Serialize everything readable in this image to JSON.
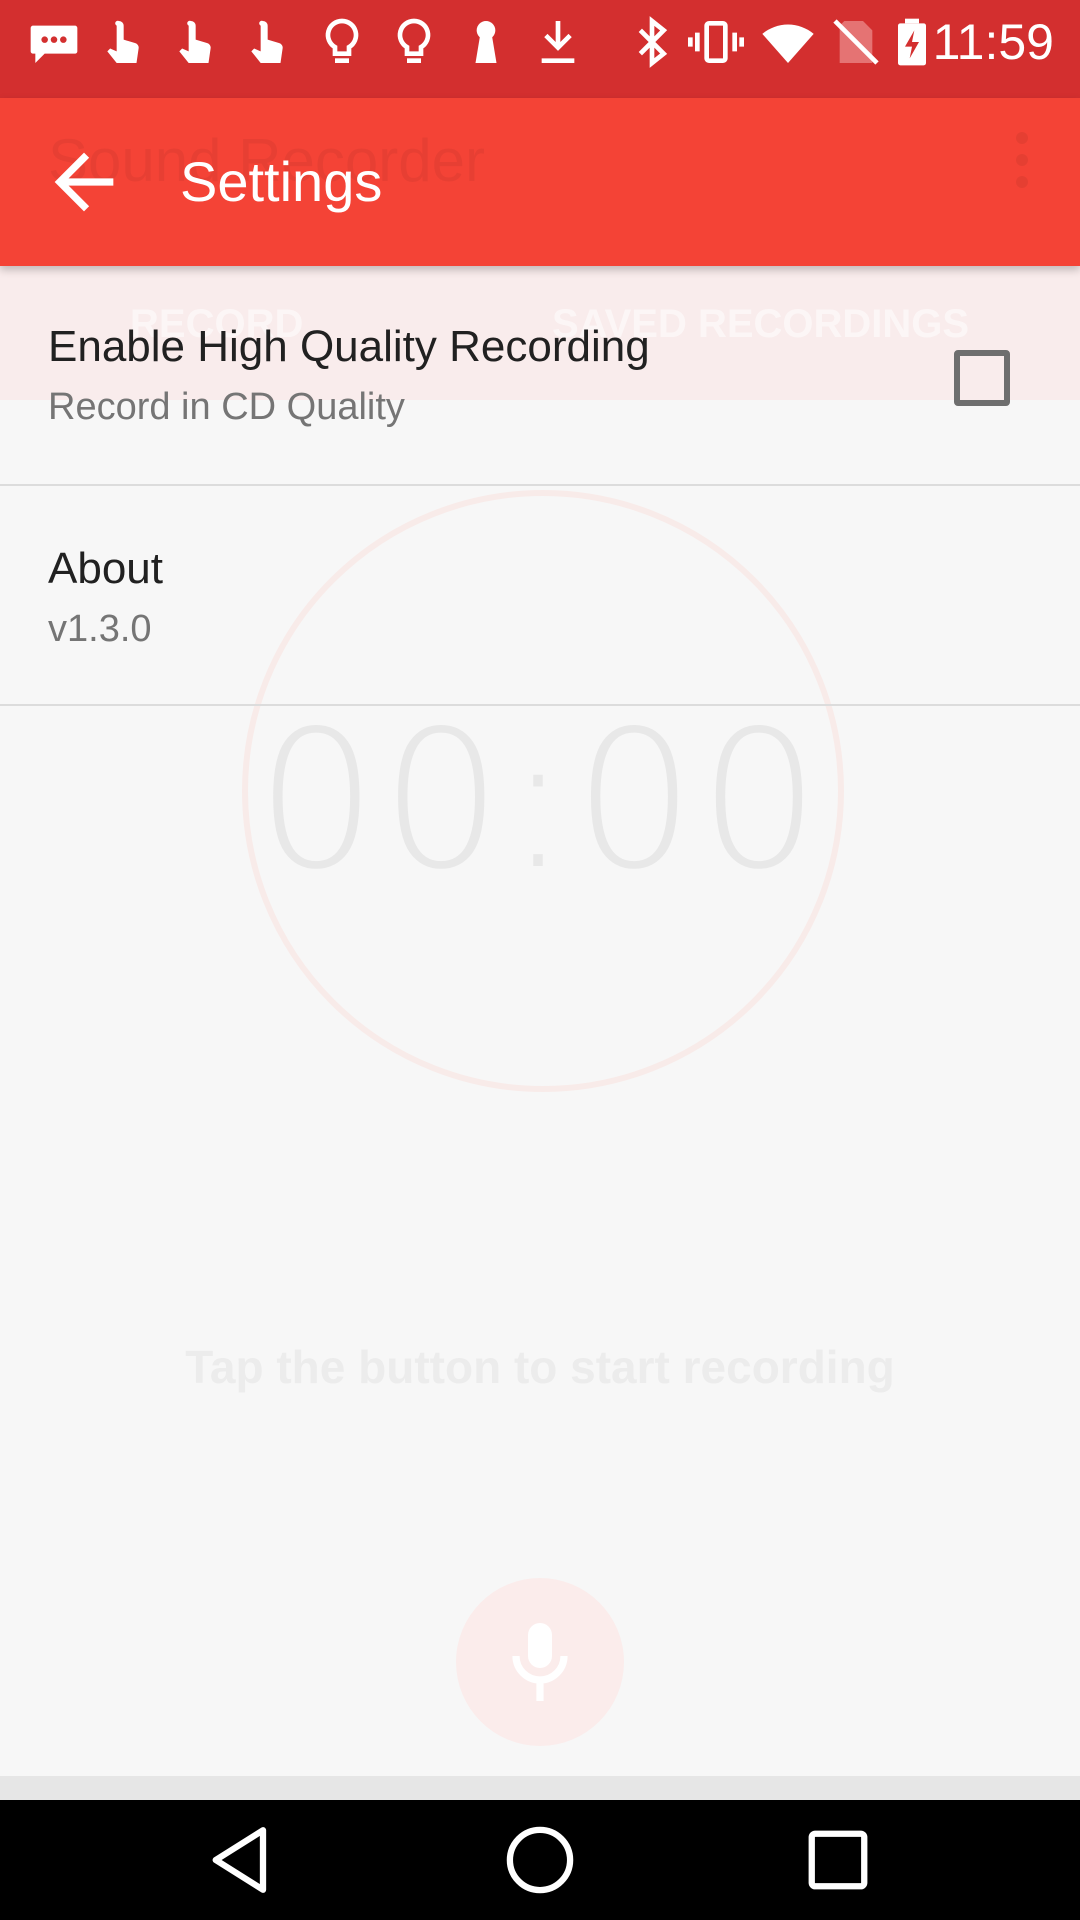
{
  "status_bar": {
    "time": "11:59",
    "icons": [
      "sms-notification-icon",
      "touch-app-icon",
      "touch-app-icon",
      "touch-app-icon",
      "lightbulb-icon",
      "lightbulb-icon",
      "keyhole-icon",
      "download-icon",
      "bluetooth-icon",
      "vibrate-icon",
      "wifi-icon",
      "no-sim-icon",
      "battery-charging-icon"
    ]
  },
  "toolbar": {
    "title": "Settings",
    "background_app_title": "Sound Recorder"
  },
  "background": {
    "tabs": [
      "RECORD",
      "SAVED RECORDINGS"
    ],
    "timer": "00:00",
    "hint": "Tap the button to start recording"
  },
  "preferences": [
    {
      "title": "Enable High Quality Recording",
      "summary": "Record in CD Quality",
      "checked": false
    },
    {
      "title": "About",
      "summary": "v1.3.0"
    }
  ],
  "colors": {
    "status_bar": "#d32f2f",
    "toolbar": "#f44336",
    "background": "#f7f7f7"
  }
}
